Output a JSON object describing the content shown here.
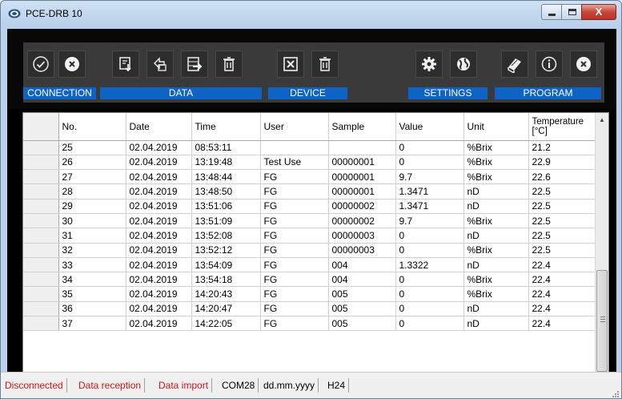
{
  "window": {
    "title": "PCE-DRB 10",
    "close_label": "X"
  },
  "toolbar": {
    "sections": {
      "connection": "CONNECTION",
      "data": "DATA",
      "device": "DEVICE",
      "settings": "SETTINGS",
      "program": "PROGRAM"
    },
    "buttons": [
      {
        "name": "connect-button",
        "icon": "check-circle-icon"
      },
      {
        "name": "disconnect-button",
        "icon": "x-circle-icon"
      },
      {
        "name": "data-download-button",
        "icon": "download-arrow-icon"
      },
      {
        "name": "data-import-button",
        "icon": "import-arrow-icon"
      },
      {
        "name": "data-export-button",
        "icon": "export-table-icon"
      },
      {
        "name": "data-delete-button",
        "icon": "trash-icon"
      },
      {
        "name": "device-read-button",
        "icon": "excel-sheet-icon"
      },
      {
        "name": "device-delete-button",
        "icon": "trash-icon"
      },
      {
        "name": "settings-button",
        "icon": "gear-icon"
      },
      {
        "name": "language-button",
        "icon": "globe-icon"
      },
      {
        "name": "manual-button",
        "icon": "book-icon"
      },
      {
        "name": "info-button",
        "icon": "info-icon"
      },
      {
        "name": "exit-button",
        "icon": "x-circle-icon"
      }
    ]
  },
  "table": {
    "columns": [
      "No.",
      "Date",
      "Time",
      "User",
      "Sample",
      "Value",
      "Unit",
      "Temperature\n[°C]"
    ],
    "rows": [
      [
        "25",
        "02.04.2019",
        "08:53:11",
        "",
        "",
        "0",
        "%Brix",
        "21.2"
      ],
      [
        "26",
        "02.04.2019",
        "13:19:48",
        "Test Use",
        "00000001",
        "0",
        "%Brix",
        "22.9"
      ],
      [
        "27",
        "02.04.2019",
        "13:48:44",
        "FG",
        "00000001",
        "9.7",
        "%Brix",
        "22.6"
      ],
      [
        "28",
        "02.04.2019",
        "13:48:50",
        "FG",
        "00000001",
        "1.3471",
        "nD",
        "22.5"
      ],
      [
        "29",
        "02.04.2019",
        "13:51:06",
        "FG",
        "00000002",
        "1.3471",
        "nD",
        "22.5"
      ],
      [
        "30",
        "02.04.2019",
        "13:51:09",
        "FG",
        "00000002",
        "9.7",
        "%Brix",
        "22.5"
      ],
      [
        "31",
        "02.04.2019",
        "13:52:08",
        "FG",
        "00000003",
        "0",
        "nD",
        "22.5"
      ],
      [
        "32",
        "02.04.2019",
        "13:52:12",
        "FG",
        "00000003",
        "0",
        "%Brix",
        "22.5"
      ],
      [
        "33",
        "02.04.2019",
        "13:54:09",
        "FG",
        "004",
        "1.3322",
        "nD",
        "22.4"
      ],
      [
        "34",
        "02.04.2019",
        "13:54:18",
        "FG",
        "004",
        "0",
        "%Brix",
        "22.4"
      ],
      [
        "35",
        "02.04.2019",
        "14:20:43",
        "FG",
        "005",
        "0",
        "%Brix",
        "22.4"
      ],
      [
        "36",
        "02.04.2019",
        "14:20:47",
        "FG",
        "005",
        "0",
        "nD",
        "22.4"
      ],
      [
        "37",
        "02.04.2019",
        "14:22:05",
        "FG",
        "005",
        "0",
        "nD",
        "22.4"
      ]
    ]
  },
  "status": {
    "disconnected": "Disconnected",
    "data_reception": "Data reception",
    "data_import": "Data import",
    "port": "COM28",
    "date_format": "dd.mm.yyyy",
    "time_format": "H24"
  },
  "colors": {
    "section_label_bg": "#0d63c6",
    "status_red": "#d4141b",
    "toolbar_bg": "#3a3a3a"
  }
}
